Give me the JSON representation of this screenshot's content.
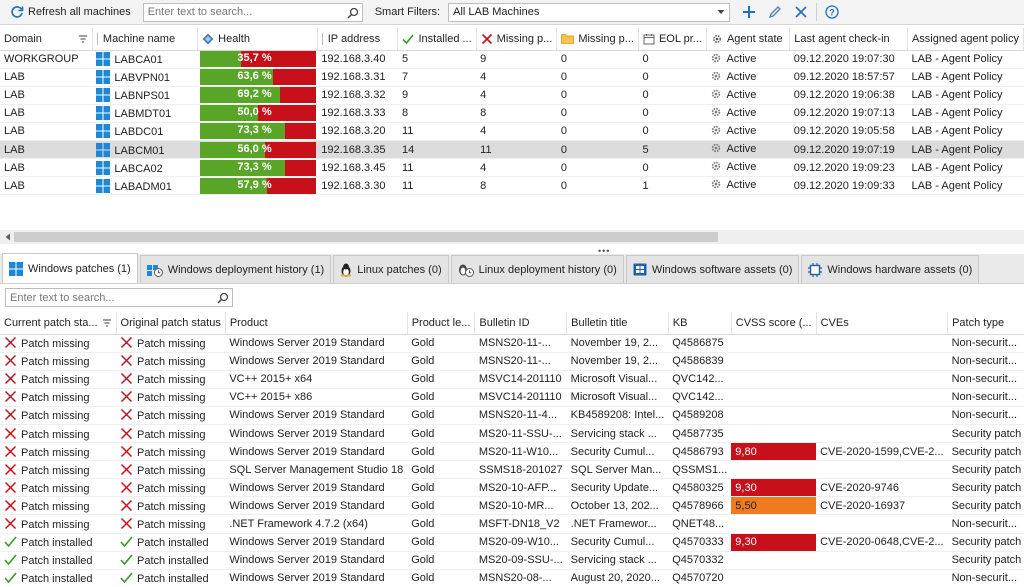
{
  "toolbar": {
    "refresh_label": "Refresh all machines",
    "search_placeholder": "Enter text to search...",
    "smart_filters_label": "Smart Filters:",
    "smart_filter_value": "All LAB Machines"
  },
  "machines": {
    "columns": [
      "Domain",
      "Machine name",
      "Health",
      "IP address",
      "Installed ...",
      "Missing p...",
      "Missing p...",
      "EOL pr...",
      "Agent state",
      "Last agent check-in",
      "Assigned agent policy"
    ],
    "rows": [
      {
        "domain": "WORKGROUP",
        "name": "LABCA01",
        "health": "35,7 %",
        "health_pct": 35.7,
        "ip": "192.168.3.40",
        "installed": "5",
        "missing1": "9",
        "missing2": "0",
        "eol": "0",
        "state": "Active",
        "checkin": "09.12.2020 19:07:30",
        "policy": "LAB - Agent Policy"
      },
      {
        "domain": "LAB",
        "name": "LABVPN01",
        "health": "63,6 %",
        "health_pct": 63.6,
        "ip": "192.168.3.31",
        "installed": "7",
        "missing1": "4",
        "missing2": "0",
        "eol": "0",
        "state": "Active",
        "checkin": "09.12.2020 18:57:57",
        "policy": "LAB - Agent Policy"
      },
      {
        "domain": "LAB",
        "name": "LABNPS01",
        "health": "69,2 %",
        "health_pct": 69.2,
        "ip": "192.168.3.32",
        "installed": "9",
        "missing1": "4",
        "missing2": "0",
        "eol": "0",
        "state": "Active",
        "checkin": "09.12.2020 19:06:38",
        "policy": "LAB - Agent Policy"
      },
      {
        "domain": "LAB",
        "name": "LABMDT01",
        "health": "50,0 %",
        "health_pct": 50.0,
        "ip": "192.168.3.33",
        "installed": "8",
        "missing1": "8",
        "missing2": "0",
        "eol": "0",
        "state": "Active",
        "checkin": "09.12.2020 19:07:13",
        "policy": "LAB - Agent Policy"
      },
      {
        "domain": "LAB",
        "name": "LABDC01",
        "health": "73,3 %",
        "health_pct": 73.3,
        "ip": "192.168.3.20",
        "installed": "11",
        "missing1": "4",
        "missing2": "0",
        "eol": "0",
        "state": "Active",
        "checkin": "09.12.2020 19:05:58",
        "policy": "LAB - Agent Policy"
      },
      {
        "domain": "LAB",
        "name": "LABCM01",
        "health": "56,0 %",
        "health_pct": 56.0,
        "ip": "192.168.3.35",
        "installed": "14",
        "missing1": "11",
        "missing2": "0",
        "eol": "5",
        "state": "Active",
        "checkin": "09.12.2020 19:07:19",
        "policy": "LAB - Agent Policy",
        "selected": true
      },
      {
        "domain": "LAB",
        "name": "LABCA02",
        "health": "73,3 %",
        "health_pct": 73.3,
        "ip": "192.168.3.45",
        "installed": "11",
        "missing1": "4",
        "missing2": "0",
        "eol": "0",
        "state": "Active",
        "checkin": "09.12.2020 19:09:23",
        "policy": "LAB - Agent Policy"
      },
      {
        "domain": "LAB",
        "name": "LABADM01",
        "health": "57,9 %",
        "health_pct": 57.9,
        "ip": "192.168.3.30",
        "installed": "11",
        "missing1": "8",
        "missing2": "0",
        "eol": "1",
        "state": "Active",
        "checkin": "09.12.2020 19:09:33",
        "policy": "LAB - Agent Policy"
      }
    ]
  },
  "tabs": [
    {
      "label": "Windows patches (1)",
      "icon": "windows-icon",
      "active": true
    },
    {
      "label": "Windows deployment history (1)",
      "icon": "windows-history-icon"
    },
    {
      "label": "Linux patches (0)",
      "icon": "linux-icon"
    },
    {
      "label": "Linux deployment history (0)",
      "icon": "linux-history-icon"
    },
    {
      "label": "Windows software assets (0)",
      "icon": "software-assets-icon"
    },
    {
      "label": "Windows hardware assets (0)",
      "icon": "hardware-assets-icon"
    }
  ],
  "patch_search_placeholder": "Enter text to search...",
  "patches": {
    "columns": [
      "Current patch sta...",
      "Original patch status",
      "Product",
      "Product le...",
      "Bulletin ID",
      "Bulletin title",
      "KB",
      "CVSS score (...",
      "CVEs",
      "Patch type"
    ],
    "rows": [
      {
        "current": "Patch missing",
        "original": "Patch missing",
        "product": "Windows Server 2019 Standard",
        "level": "Gold",
        "bulletin": "MSNS20-11-...",
        "title": "November 19, 2...",
        "kb": "Q4586875",
        "cvss": "",
        "cves": "",
        "type": "Non-securit..."
      },
      {
        "current": "Patch missing",
        "original": "Patch missing",
        "product": "Windows Server 2019 Standard",
        "level": "Gold",
        "bulletin": "MSNS20-11-...",
        "title": "November 19, 2...",
        "kb": "Q4586839",
        "cvss": "",
        "cves": "",
        "type": "Non-securit..."
      },
      {
        "current": "Patch missing",
        "original": "Patch missing",
        "product": "VC++ 2015+ x64",
        "level": "Gold",
        "bulletin": "MSVC14-201110",
        "title": "Microsoft Visual...",
        "kb": "QVC142...",
        "cvss": "",
        "cves": "",
        "type": "Non-securit..."
      },
      {
        "current": "Patch missing",
        "original": "Patch missing",
        "product": "VC++ 2015+ x86",
        "level": "Gold",
        "bulletin": "MSVC14-201110",
        "title": "Microsoft Visual...",
        "kb": "QVC142...",
        "cvss": "",
        "cves": "",
        "type": "Non-securit..."
      },
      {
        "current": "Patch missing",
        "original": "Patch missing",
        "product": "Windows Server 2019 Standard",
        "level": "Gold",
        "bulletin": "MSNS20-11-4...",
        "title": "KB4589208: Intel...",
        "kb": "Q4589208",
        "cvss": "",
        "cves": "",
        "type": "Non-securit..."
      },
      {
        "current": "Patch missing",
        "original": "Patch missing",
        "product": "Windows Server 2019 Standard",
        "level": "Gold",
        "bulletin": "MS20-11-SSU-...",
        "title": "Servicing stack ...",
        "kb": "Q4587735",
        "cvss": "",
        "cves": "",
        "type": "Security patch"
      },
      {
        "current": "Patch missing",
        "original": "Patch missing",
        "product": "Windows Server 2019 Standard",
        "level": "Gold",
        "bulletin": "MS20-11-W10...",
        "title": "Security Cumul...",
        "kb": "Q4586793",
        "cvss": "9,80",
        "cvss_level": "red",
        "cves": "CVE-2020-1599,CVE-2...",
        "type": "Security patch"
      },
      {
        "current": "Patch missing",
        "original": "Patch missing",
        "product": "SQL Server Management Studio 18",
        "level": "Gold",
        "bulletin": "SSMS18-201027",
        "title": "SQL Server Man...",
        "kb": "QSSMS1...",
        "cvss": "",
        "cves": "",
        "type": "Security patch"
      },
      {
        "current": "Patch missing",
        "original": "Patch missing",
        "product": "Windows Server 2019 Standard",
        "level": "Gold",
        "bulletin": "MS20-10-AFP...",
        "title": "Security Update...",
        "kb": "Q4580325",
        "cvss": "9,30",
        "cvss_level": "red",
        "cves": "CVE-2020-9746",
        "type": "Security patch"
      },
      {
        "current": "Patch missing",
        "original": "Patch missing",
        "product": "Windows Server 2019 Standard",
        "level": "Gold",
        "bulletin": "MS20-10-MR...",
        "title": "October 13, 202...",
        "kb": "Q4578966",
        "cvss": "5,50",
        "cvss_level": "orange",
        "cves": "CVE-2020-16937",
        "type": "Security patch"
      },
      {
        "current": "Patch missing",
        "original": "Patch missing",
        "product": ".NET Framework 4.7.2 (x64)",
        "level": "Gold",
        "bulletin": "MSFT-DN18_V2",
        "title": ".NET Framewor...",
        "kb": "QNET48...",
        "cvss": "",
        "cves": "",
        "type": "Non-securit..."
      },
      {
        "current": "Patch installed",
        "original": "Patch installed",
        "product": "Windows Server 2019 Standard",
        "level": "Gold",
        "bulletin": "MS20-09-W10...",
        "title": "Security Cumul...",
        "kb": "Q4570333",
        "cvss": "9,30",
        "cvss_level": "red",
        "cves": "CVE-2020-0648,CVE-2...",
        "type": "Security patch"
      },
      {
        "current": "Patch installed",
        "original": "Patch installed",
        "product": "Windows Server 2019 Standard",
        "level": "Gold",
        "bulletin": "MS20-09-SSU-...",
        "title": "Servicing stack ...",
        "kb": "Q4570332",
        "cvss": "",
        "cves": "",
        "type": "Security patch"
      },
      {
        "current": "Patch installed",
        "original": "Patch installed",
        "product": "Windows Server 2019 Standard",
        "level": "Gold",
        "bulletin": "MSNS20-08-...",
        "title": "August 20, 2020...",
        "kb": "Q4570720",
        "cvss": "",
        "cves": "",
        "type": "Non-securit..."
      }
    ]
  }
}
